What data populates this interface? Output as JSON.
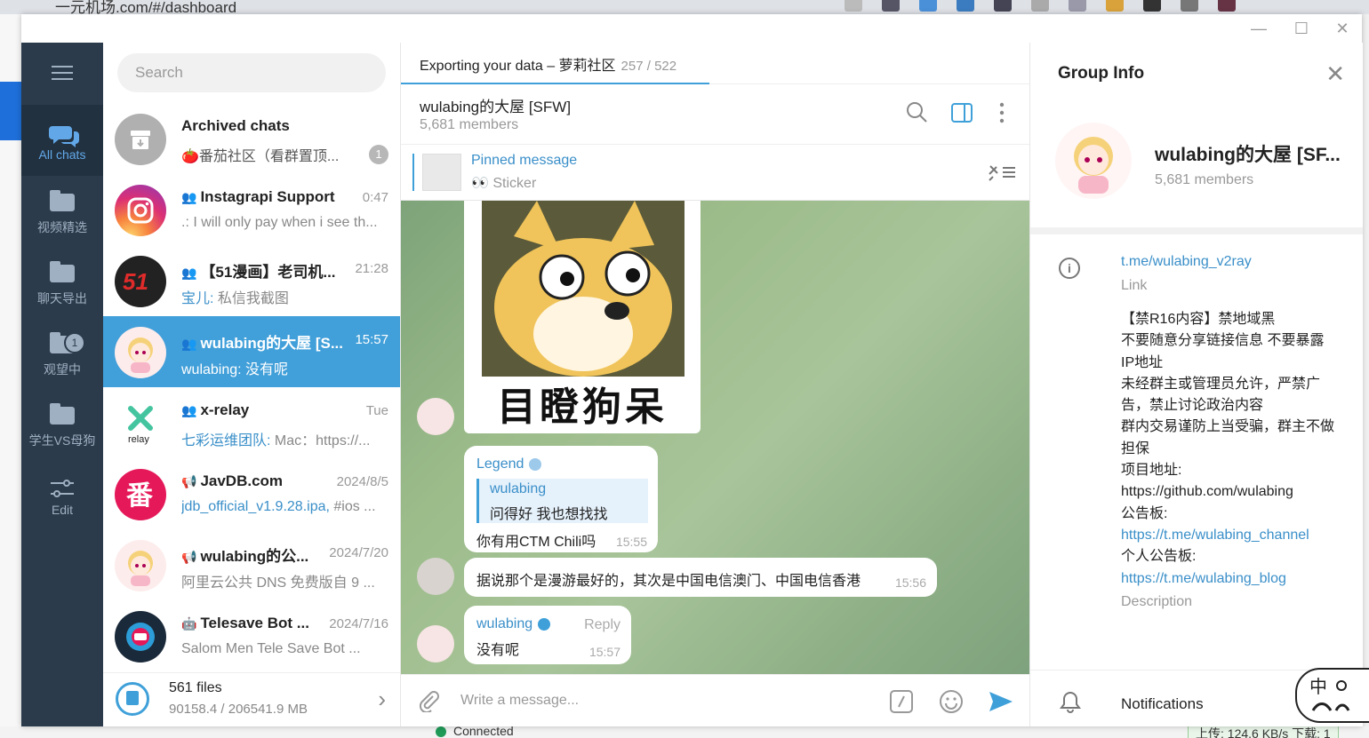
{
  "browser": {
    "url": "一元机场.com/#/dashboard"
  },
  "window": {
    "minimize": "—",
    "maximize": "☐",
    "close": "✕"
  },
  "rail": {
    "folders": [
      {
        "label": "All chats",
        "active": true
      },
      {
        "label": "视频精选"
      },
      {
        "label": "聊天导出"
      },
      {
        "label": "观望中",
        "badge": "1"
      },
      {
        "label": "学生VS母狗"
      },
      {
        "label": "Edit"
      }
    ]
  },
  "search": {
    "placeholder": "Search"
  },
  "chats": [
    {
      "name": "Archived chats",
      "msg": "🍅番茄社区（看群置顶...",
      "unread": "1"
    },
    {
      "name": "Instagrapi Support",
      "time": "0:47",
      "msg": ".: I will only pay when i see th..."
    },
    {
      "name": "【51漫画】老司机...",
      "time": "21:28",
      "sender": "宝儿:",
      "msg": " 私信我截图"
    },
    {
      "name": "wulabing的大屋 [S...",
      "time": "15:57",
      "sender": "wulabing:",
      "msg": " 没有呢"
    },
    {
      "name": "x-relay",
      "time": "Tue",
      "sender": "七彩运维团队:",
      "msg": " Mac：https://..."
    },
    {
      "name": "JavDB.com",
      "time": "2024/8/5",
      "sender": "jdb_official_v1.9.28.ipa,",
      "msg": " #ios ..."
    },
    {
      "name": "wulabing的公...",
      "time": "2024/7/20",
      "msg": "阿里云公共 DNS 免费版自 9 ..."
    },
    {
      "name": "Telesave Bot ...",
      "time": "2024/7/16",
      "msg": "Salom Men Tele Save Bot ..."
    }
  ],
  "files": {
    "count": "561 files",
    "size": "90158.4 / 206541.9 MB"
  },
  "export": {
    "label": "Exporting your data – 萝莉社区",
    "progress": "257 / 522"
  },
  "header": {
    "title": "wulabing的大屋 [SFW]",
    "members": "5,681 members"
  },
  "pinned": {
    "title": "Pinned message",
    "text": "👀 Sticker"
  },
  "sticker_caption": "目瞪狗呆",
  "messages": [
    {
      "from": "Legend",
      "quote_name": "wulabing",
      "quote_text": "问得好 我也想找找",
      "text": "你有用CTM Chili吗",
      "time": "15:55"
    },
    {
      "text": "据说那个是漫游最好的，其次是中国电信澳门、中国电信香港",
      "time": "15:56"
    },
    {
      "from": "wulabing",
      "reply": "Reply",
      "text": "没有呢",
      "time": "15:57"
    }
  ],
  "composer": {
    "placeholder": "Write a message..."
  },
  "info": {
    "heading": "Group Info",
    "name": "wulabing的大屋 [SF...",
    "members": "5,681 members",
    "link": "t.me/wulabing_v2ray",
    "link_label": "Link",
    "desc_lines": [
      "【禁R16内容】禁地域黑",
      "不要随意分享链接信息 不要暴露IP地址",
      "未经群主或管理员允许，严禁广告，禁止讨论政治内容",
      "群内交易谨防上当受骗，群主不做担保",
      "项目地址: https://github.com/wulabing",
      "公告板:"
    ],
    "channel_link": "https://t.me/wulabing_channel",
    "blog_label": "个人公告板:",
    "blog_link": "https://t.me/wulabing_blog",
    "desc_label": "Description",
    "notifications": "Notifications"
  },
  "status": {
    "connected": "Connected",
    "speed": "上传: 124.6 KB/s  下载: 1"
  }
}
